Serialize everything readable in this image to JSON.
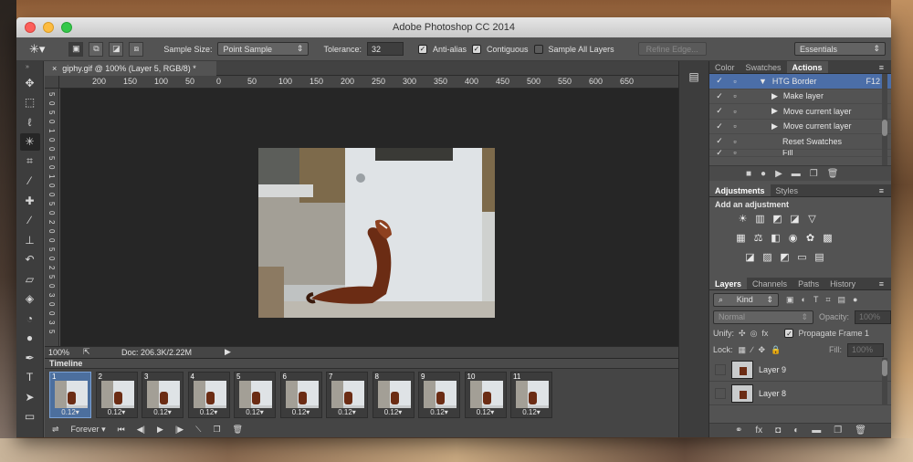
{
  "window": {
    "title": "Adobe Photoshop CC 2014"
  },
  "options_bar": {
    "sample_size_label": "Sample Size:",
    "sample_size_value": "Point Sample",
    "tolerance_label": "Tolerance:",
    "tolerance_value": "32",
    "anti_alias": {
      "label": "Anti-alias",
      "checked": true
    },
    "contiguous": {
      "label": "Contiguous",
      "checked": true
    },
    "sample_all_layers": {
      "label": "Sample All Layers",
      "checked": false
    },
    "refine_edge": "Refine Edge...",
    "workspace": "Essentials"
  },
  "document": {
    "tab_title": "giphy.gif @ 100% (Layer 5, RGB/8) *",
    "zoom": "100%",
    "doc_info": "Doc: 206.3K/2.22M",
    "ruler_h": [
      "200",
      "150",
      "100",
      "50",
      "0",
      "50",
      "100",
      "150",
      "200",
      "250",
      "300",
      "350",
      "400",
      "450",
      "500",
      "550",
      "600",
      "650"
    ],
    "ruler_v": [
      "5",
      "0",
      "5",
      "0",
      "1",
      "0",
      "0",
      "5",
      "0",
      "1",
      "0",
      "0",
      "5",
      "0",
      "2",
      "0",
      "0",
      "5",
      "0",
      "2",
      "5",
      "0",
      "3",
      "0",
      "0",
      "3",
      "5"
    ]
  },
  "timeline": {
    "title": "Timeline",
    "frames": [
      {
        "num": "1",
        "dur": "0.12▾"
      },
      {
        "num": "2",
        "dur": "0.12▾"
      },
      {
        "num": "3",
        "dur": "0.12▾"
      },
      {
        "num": "4",
        "dur": "0.12▾"
      },
      {
        "num": "5",
        "dur": "0.12▾"
      },
      {
        "num": "6",
        "dur": "0.12▾"
      },
      {
        "num": "7",
        "dur": "0.12▾"
      },
      {
        "num": "8",
        "dur": "0.12▾"
      },
      {
        "num": "9",
        "dur": "0.12▾"
      },
      {
        "num": "10",
        "dur": "0.12▾"
      },
      {
        "num": "11",
        "dur": "0.12▾"
      }
    ],
    "loop": "Forever"
  },
  "actions_panel": {
    "tabs": [
      "Color",
      "Swatches",
      "Actions"
    ],
    "items": [
      {
        "label": "HTG Border",
        "shortcut": "F12",
        "level": 1
      },
      {
        "label": "Make layer",
        "level": 2
      },
      {
        "label": "Move current layer",
        "level": 2
      },
      {
        "label": "Move current layer",
        "level": 2
      },
      {
        "label": "Reset Swatches",
        "level": 2
      },
      {
        "label": "Fill",
        "level": 2
      }
    ]
  },
  "adjustments_panel": {
    "tabs": [
      "Adjustments",
      "Styles"
    ],
    "heading": "Add an adjustment"
  },
  "layers_panel": {
    "tabs": [
      "Layers",
      "Channels",
      "Paths",
      "History"
    ],
    "filter": "Kind",
    "blend_mode": "Normal",
    "opacity_label": "Opacity:",
    "opacity_value": "100%",
    "unify_label": "Unify:",
    "propagate_label": "Propagate Frame 1",
    "lock_label": "Lock:",
    "fill_label": "Fill:",
    "fill_value": "100%",
    "layers": [
      {
        "name": "Layer 9"
      },
      {
        "name": "Layer 8"
      }
    ]
  }
}
